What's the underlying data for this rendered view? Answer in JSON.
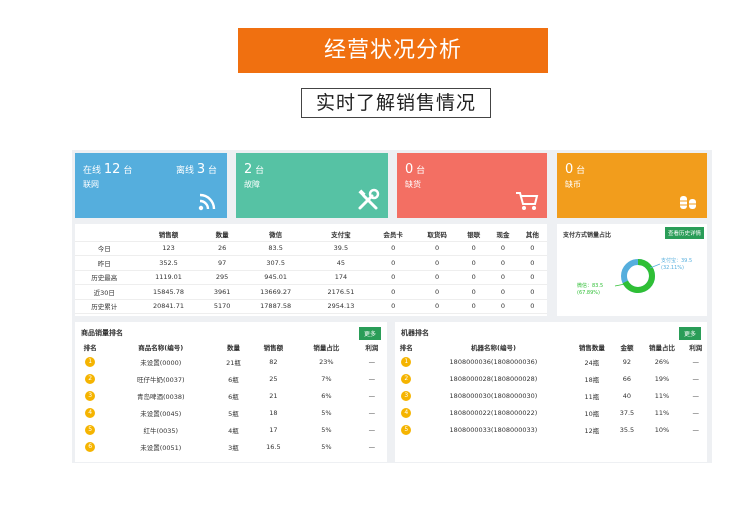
{
  "banner": {
    "title": "经营状况分析",
    "subtitle": "实时了解销售情况"
  },
  "cards": [
    {
      "color": "#55aedd",
      "line1_label": "在线",
      "line1_value": "12",
      "line1_unit": "台",
      "line2": "联网",
      "right_label": "离线",
      "right_value": "3",
      "right_unit": "台",
      "icon": "wifi-icon"
    },
    {
      "color": "#56c2a4",
      "line1_value": "2",
      "line1_unit": "台",
      "line2": "故障",
      "icon": "tools-icon"
    },
    {
      "color": "#f36f63",
      "line1_value": "0",
      "line1_unit": "台",
      "line2": "缺货",
      "icon": "cart-icon"
    },
    {
      "color": "#f29d1c",
      "line1_value": "0",
      "line1_unit": "台",
      "line2": "缺币",
      "icon": "coins-icon"
    }
  ],
  "summary": {
    "headers": [
      "",
      "销售额",
      "数量",
      "微信",
      "支付宝",
      "会员卡",
      "取货码",
      "银联",
      "现金",
      "其他"
    ],
    "rows": [
      [
        "今日",
        "123",
        "26",
        "83.5",
        "39.5",
        "0",
        "0",
        "0",
        "0",
        "0"
      ],
      [
        "昨日",
        "352.5",
        "97",
        "307.5",
        "45",
        "0",
        "0",
        "0",
        "0",
        "0"
      ],
      [
        "历史最高",
        "1119.01",
        "295",
        "945.01",
        "174",
        "0",
        "0",
        "0",
        "0",
        "0"
      ],
      [
        "近30日",
        "15845.78",
        "3961",
        "13669.27",
        "2176.51",
        "0",
        "0",
        "0",
        "0",
        "0"
      ],
      [
        "历史累计",
        "20841.71",
        "5170",
        "17887.58",
        "2954.13",
        "0",
        "0",
        "0",
        "0",
        "0"
      ]
    ]
  },
  "payment": {
    "title": "支付方式销量占比",
    "button": "查看历史详情",
    "wechat_label": "微信：83.5",
    "wechat_pct": "(67.89%)",
    "wechat_share": 0.6789,
    "alipay_label": "支付宝：39.5",
    "alipay_pct": "(32.11%)",
    "wechat_color": "#2fbf35",
    "alipay_color": "#55aedd"
  },
  "product_rank": {
    "title": "商品销量排名",
    "more": "更多",
    "headers": [
      "排名",
      "商品名称(编号)",
      "数量",
      "销售额",
      "销量占比",
      "利润"
    ],
    "rows": [
      [
        "1",
        "未设置(0000)",
        "21瓶",
        "82",
        "23%",
        "—"
      ],
      [
        "2",
        "旺仔牛奶(0037)",
        "6瓶",
        "25",
        "7%",
        "—"
      ],
      [
        "3",
        "青岛啤酒(0038)",
        "6瓶",
        "21",
        "6%",
        "—"
      ],
      [
        "4",
        "未设置(0045)",
        "5瓶",
        "18",
        "5%",
        "—"
      ],
      [
        "5",
        "红牛(0035)",
        "4瓶",
        "17",
        "5%",
        "—"
      ],
      [
        "6",
        "未设置(0051)",
        "3瓶",
        "16.5",
        "5%",
        "—"
      ]
    ]
  },
  "machine_rank": {
    "title": "机器排名",
    "more": "更多",
    "headers": [
      "排名",
      "机器名称(编号)",
      "销售数量",
      "金额",
      "销量占比",
      "利润"
    ],
    "rows": [
      [
        "1",
        "1808000036(1808000036)",
        "24瓶",
        "92",
        "26%",
        "—"
      ],
      [
        "2",
        "1808000028(1808000028)",
        "18瓶",
        "66",
        "19%",
        "—"
      ],
      [
        "3",
        "1808000030(1808000030)",
        "11瓶",
        "40",
        "11%",
        "—"
      ],
      [
        "4",
        "1808000022(1808000022)",
        "10瓶",
        "37.5",
        "11%",
        "—"
      ],
      [
        "5",
        "1808000033(1808000033)",
        "12瓶",
        "35.5",
        "10%",
        "—"
      ]
    ]
  }
}
